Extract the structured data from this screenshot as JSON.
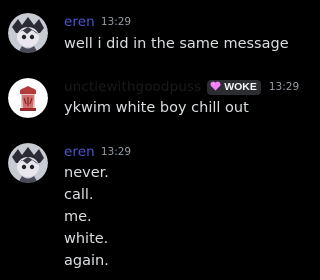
{
  "messages": [
    {
      "username": "eren",
      "username_color": "#4d55d0",
      "timestamp": "13:29",
      "lines": [
        "well i did in the same message"
      ]
    },
    {
      "username": "unctiewithgoodpuss",
      "username_color": "#1a1a1a",
      "role_tag": {
        "label": "WOKE",
        "icon": "heart-icon",
        "color": "#f47fff"
      },
      "timestamp": "13:29",
      "lines": [
        "ykwim white boy chill out"
      ]
    },
    {
      "username": "eren",
      "username_color": "#4d55d0",
      "timestamp": "13:29",
      "lines": [
        "never.",
        "call.",
        "me.",
        "white.",
        "again."
      ]
    }
  ]
}
